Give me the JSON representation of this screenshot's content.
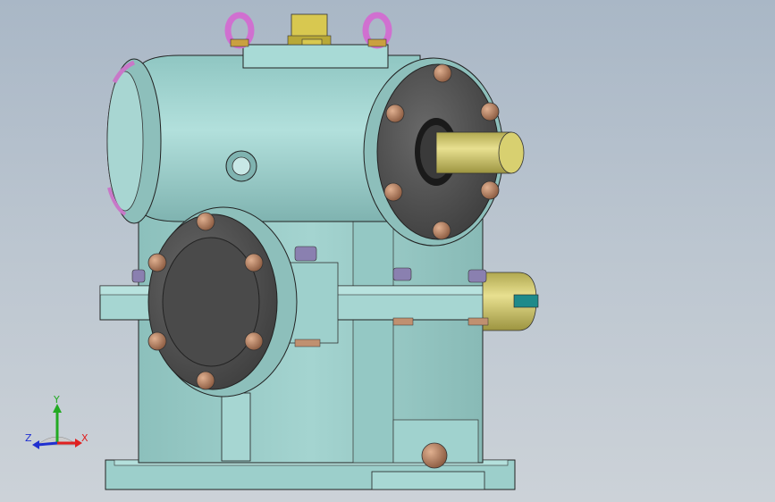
{
  "triad": {
    "x_label": "X",
    "y_label": "Y",
    "z_label": "Z",
    "x_color": "#e02020",
    "y_color": "#22aa22",
    "z_color": "#2030d0"
  },
  "colors": {
    "housing": "#9ccfcb",
    "housing_dark": "#7fb3b0",
    "cover": "#5a5a5a",
    "bolt": "#b98a6e",
    "shaft": "#cfc86a",
    "lifting_eye": "#d070d0"
  }
}
